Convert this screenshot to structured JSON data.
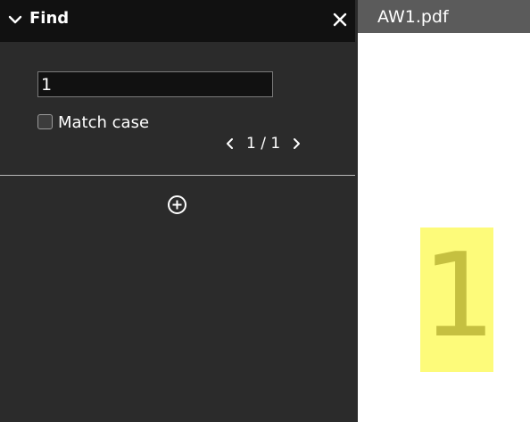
{
  "find_panel": {
    "title": "Find",
    "icons": {
      "collapse": "chevron-down-icon",
      "close": "close-icon",
      "previous": "chevron-left-icon",
      "next": "chevron-right-icon",
      "add": "plus-circle-icon"
    },
    "search": {
      "value": "1",
      "placeholder": ""
    },
    "match_case": {
      "label": "Match case",
      "checked": false
    },
    "pager": {
      "text": "1 / 1"
    }
  },
  "document": {
    "tab_title": "AW1.pdf",
    "page_content": "1",
    "highlight_color": "#fdfb7a",
    "text_color": "#c5c040"
  },
  "colors": {
    "panel_bg": "#2b2b2b",
    "header_bg": "#111111",
    "tab_bg": "#5b5b5b"
  }
}
